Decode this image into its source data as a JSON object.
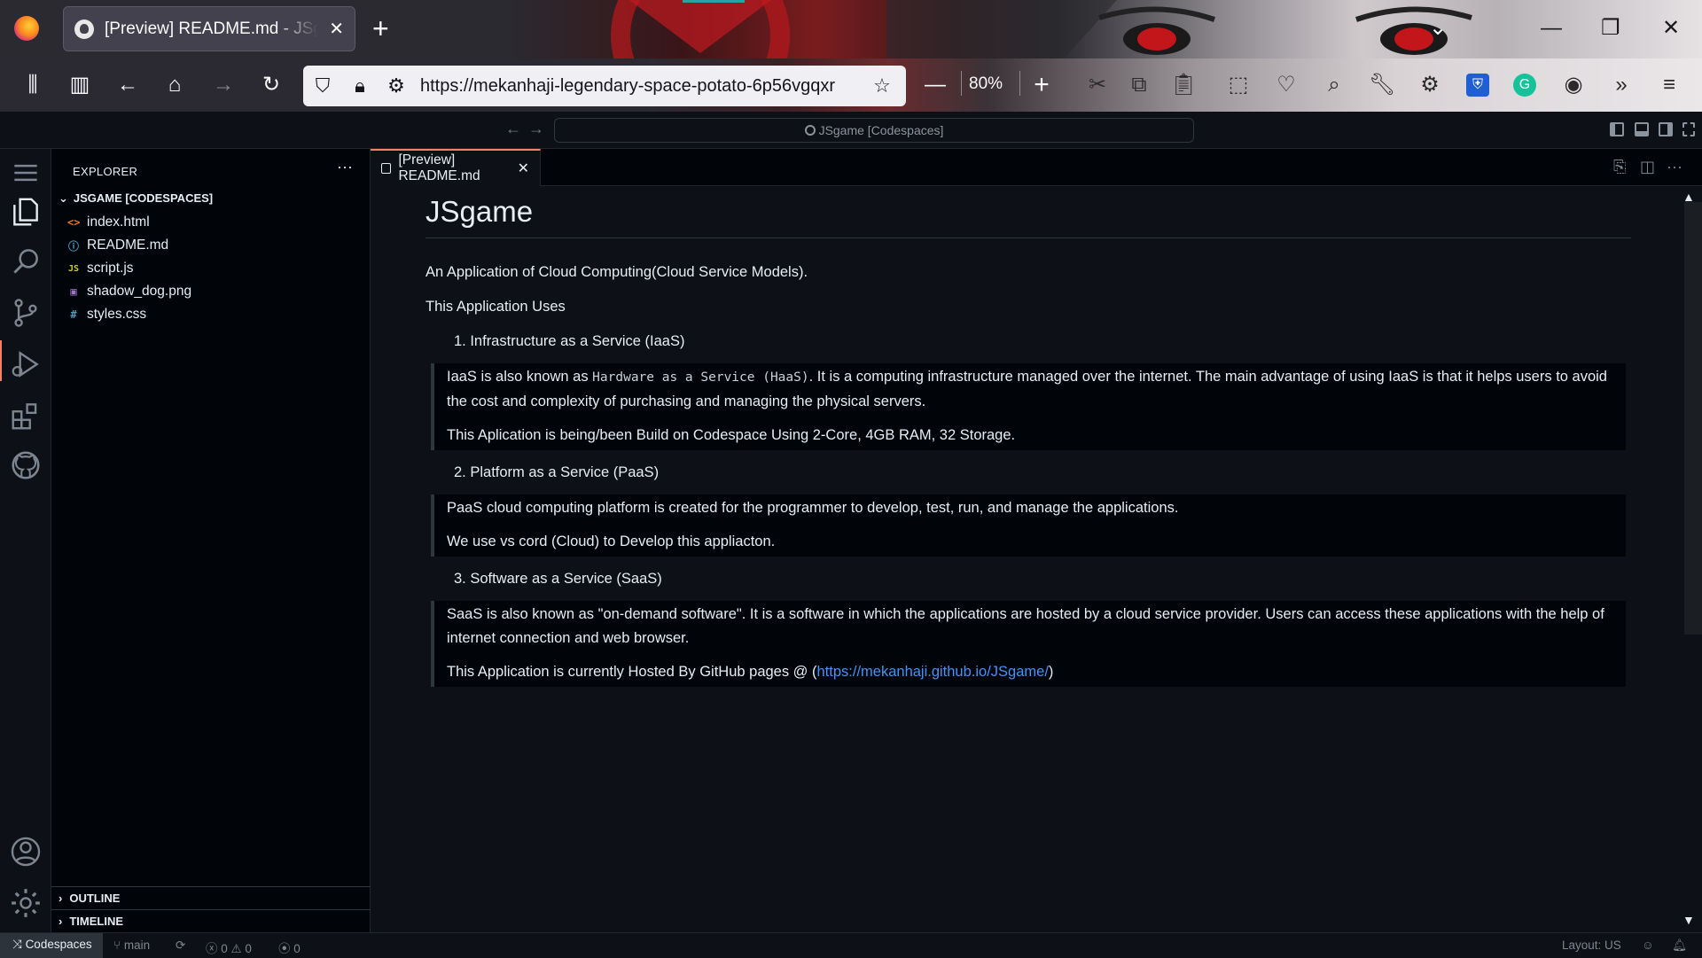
{
  "browser": {
    "tab_title": "[Preview] README.md - JSgame [Codespaces]",
    "tab_close": "✕",
    "new_tab": "+",
    "url": "https://mekanhaji-legendary-space-potato-6p56vgqxr",
    "zoom": "80%",
    "zoom_minus": "—",
    "zoom_plus": "+"
  },
  "vscode": {
    "command_center": "JSgame [Codespaces]",
    "explorer": {
      "header": "EXPLORER",
      "more": "···",
      "folder": "JSGAME [CODESPACES]",
      "files": [
        {
          "name": "index.html",
          "icon": "<>",
          "color": "#e37933"
        },
        {
          "name": "README.md",
          "icon": "ⓘ",
          "color": "#519aba"
        },
        {
          "name": "script.js",
          "icon": "JS",
          "color": "#cbcb41"
        },
        {
          "name": "shadow_dog.png",
          "icon": "▣",
          "color": "#a074c4"
        },
        {
          "name": "styles.css",
          "icon": "#",
          "color": "#519aba"
        }
      ],
      "outline": "OUTLINE",
      "timeline": "TIMELINE"
    },
    "editor_tab": "[Preview] README.md",
    "editor_tab_close": "✕",
    "readme": {
      "h1": "JSgame",
      "intro": "An Application of Cloud Computing(Cloud Service Models).",
      "uses": "This Application Uses",
      "item1": "1. Infrastructure as a Service (IaaS)",
      "bq1_prefix": "IaaS is also known as ",
      "bq1_code": "Hardware as a Service (HaaS)",
      "bq1_suffix": ". It is a computing infrastructure managed over the internet. The main advantage of using IaaS is that it helps users to avoid the cost and complexity of purchasing and managing the physical servers.",
      "bq1_p2": "This Aplication is being/been Build on Codespace Using 2-Core, 4GB RAM, 32 Storage.",
      "item2": "2. Platform as a Service (PaaS)",
      "bq2_p1": "PaaS cloud computing platform is created for the programmer to develop, test, run, and manage the applications.",
      "bq2_p2": "We use vs cord (Cloud) to Develop this appliacton.",
      "item3": "3. Software as a Service (SaaS)",
      "bq3_p1": "SaaS is also known as \"on-demand software\". It is a software in which the applications are hosted by a cloud service provider. Users can access these applications with the help of internet connection and web browser.",
      "bq3_p2_prefix": "This Application is currently Hosted By GitHub pages @ (",
      "bq3_link": "https://mekanhaji.github.io/JSgame/",
      "bq3_p2_suffix": ")"
    },
    "status": {
      "remote": "Codespaces",
      "branch": "main",
      "errors": "0",
      "warnings": "0",
      "ports": "0",
      "layout": "Layout: US"
    }
  }
}
